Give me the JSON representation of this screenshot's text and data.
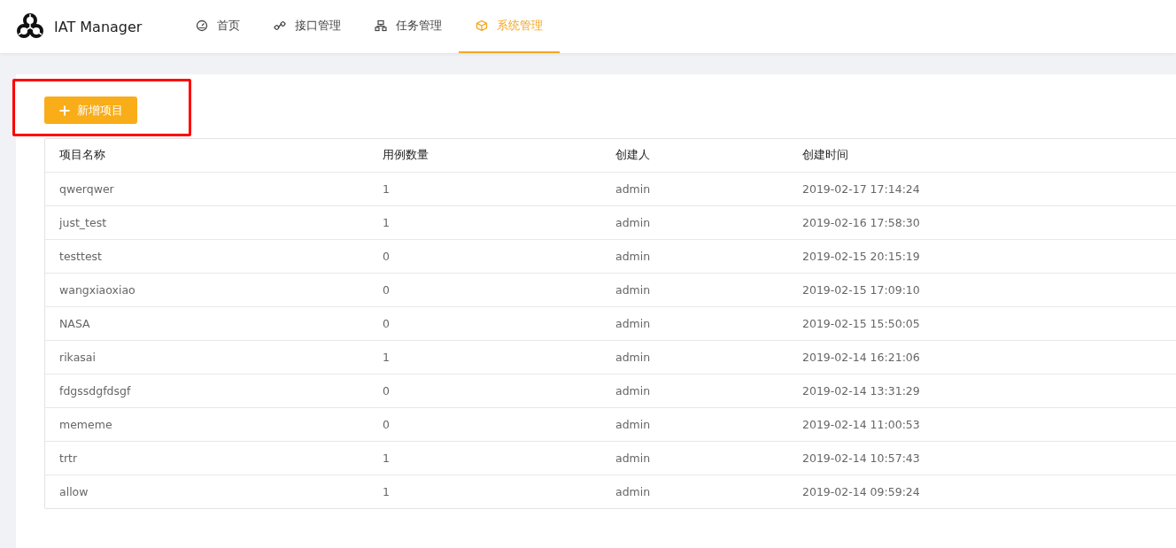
{
  "app": {
    "title": "IAT Manager"
  },
  "nav": [
    {
      "label": "首页",
      "selected": false
    },
    {
      "label": "接口管理",
      "selected": false
    },
    {
      "label": "任务管理",
      "selected": false
    },
    {
      "label": "系统管理",
      "selected": true
    }
  ],
  "add_button": {
    "label": "新增项目",
    "highlighted": true
  },
  "table": {
    "columns": [
      "项目名称",
      "用例数量",
      "创建人",
      "创建时间"
    ],
    "rows": [
      [
        "qwerqwer",
        "1",
        "admin",
        "2019-02-17 17:14:24"
      ],
      [
        "just_test",
        "1",
        "admin",
        "2019-02-16 17:58:30"
      ],
      [
        "testtest",
        "0",
        "admin",
        "2019-02-15 20:15:19"
      ],
      [
        "wangxiaoxiao",
        "0",
        "admin",
        "2019-02-15 17:09:10"
      ],
      [
        "NASA",
        "0",
        "admin",
        "2019-02-15 15:50:05"
      ],
      [
        "rikasai",
        "1",
        "admin",
        "2019-02-14 16:21:06"
      ],
      [
        "fdgssdgfdsgf",
        "0",
        "admin",
        "2019-02-14 13:31:29"
      ],
      [
        "mememe",
        "0",
        "admin",
        "2019-02-14 11:00:53"
      ],
      [
        "trtr",
        "1",
        "admin",
        "2019-02-14 10:57:43"
      ],
      [
        "allow",
        "1",
        "admin",
        "2019-02-14 09:59:24"
      ]
    ]
  }
}
